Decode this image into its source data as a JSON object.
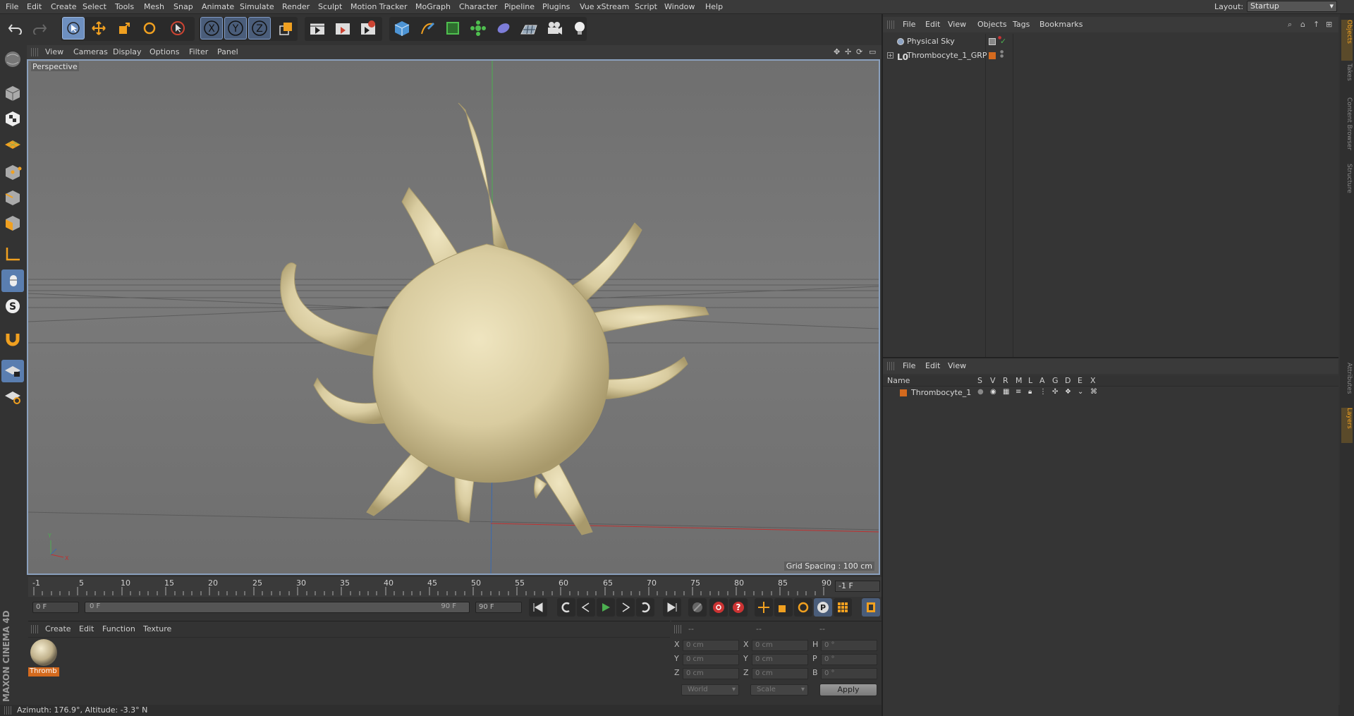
{
  "menubar": {
    "items": [
      "File",
      "Edit",
      "Create",
      "Select",
      "Tools",
      "Mesh",
      "Snap",
      "Animate",
      "Simulate",
      "Render",
      "Sculpt",
      "Motion Tracker",
      "MoGraph",
      "Character",
      "Pipeline",
      "Plugins",
      "Vue xStream",
      "Script",
      "Window",
      "Help"
    ],
    "layout_label": "Layout:",
    "layout_value": "Startup"
  },
  "viewport": {
    "menu": [
      "View",
      "Cameras",
      "Display",
      "Options",
      "Filter",
      "Panel"
    ],
    "label": "Perspective",
    "grid_spacing": "Grid Spacing : 100 cm"
  },
  "timeline": {
    "ticks": [
      "-1",
      "5",
      "10",
      "15",
      "20",
      "25",
      "30",
      "35",
      "40",
      "45",
      "50",
      "55",
      "60",
      "65",
      "70",
      "75",
      "80",
      "85",
      "90"
    ],
    "current_frame_right": "-1 F",
    "start_field": "0 F",
    "slider_left": "0 F",
    "slider_right": "90 F",
    "end_field": "90 F"
  },
  "material_panel": {
    "menu": [
      "Create",
      "Edit",
      "Function",
      "Texture"
    ],
    "material_name": "Thromb"
  },
  "coord_panel": {
    "header": [
      "--",
      "--",
      "--"
    ],
    "rows": [
      {
        "l1": "X",
        "v1": "0 cm",
        "l2": "X",
        "v2": "0 cm",
        "l3": "H",
        "v3": "0 °"
      },
      {
        "l1": "Y",
        "v1": "0 cm",
        "l2": "Y",
        "v2": "0 cm",
        "l3": "P",
        "v3": "0 °"
      },
      {
        "l1": "Z",
        "v1": "0 cm",
        "l2": "Z",
        "v2": "0 cm",
        "l3": "B",
        "v3": "0 °"
      }
    ],
    "world": "World",
    "scale": "Scale",
    "apply": "Apply"
  },
  "object_manager": {
    "menu": [
      "File",
      "Edit",
      "View",
      "Objects",
      "Tags",
      "Bookmarks"
    ],
    "objects": [
      "Physical Sky",
      "Thrombocyte_1_GRP"
    ]
  },
  "layer_manager": {
    "menu": [
      "File",
      "Edit",
      "View"
    ],
    "columns": [
      "Name",
      "S",
      "V",
      "R",
      "M",
      "L",
      "A",
      "G",
      "D",
      "E",
      "X"
    ],
    "layers": [
      "Thrombocyte_1"
    ],
    "layer_color": "#d46a1e"
  },
  "right_tabs": [
    "Objects",
    "Takes",
    "Content Browser",
    "Structure",
    "Attributes",
    "Layers"
  ],
  "brand": "MAXON CINEMA 4D",
  "status": "Azimuth: 176.9°, Altitude: -3.3°  N",
  "colors": {
    "accent": "#6d8fbf",
    "object": "#e0d3a6",
    "orange": "#d46a1e"
  }
}
